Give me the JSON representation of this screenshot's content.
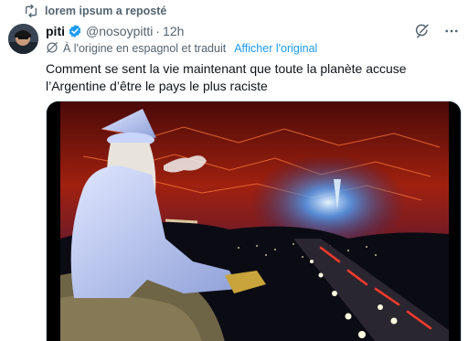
{
  "repost": {
    "text": "lorem ipsum a reposté",
    "icon": "repost-icon"
  },
  "author": {
    "display_name": "piti",
    "handle": "@nosoypitti",
    "separator": "·",
    "time": "12h",
    "verified_color": "#1d9bf0"
  },
  "translation": {
    "note": "À l'origine en espagnol et traduit",
    "link": "Afficher l'original"
  },
  "tweet": {
    "text": "Comment se sent la vie maintenant que toute la planète accuse l’Argentine d’être le pays le plus raciste"
  },
  "colors": {
    "accent": "#1d9bf0",
    "secondary_text": "#536471"
  }
}
